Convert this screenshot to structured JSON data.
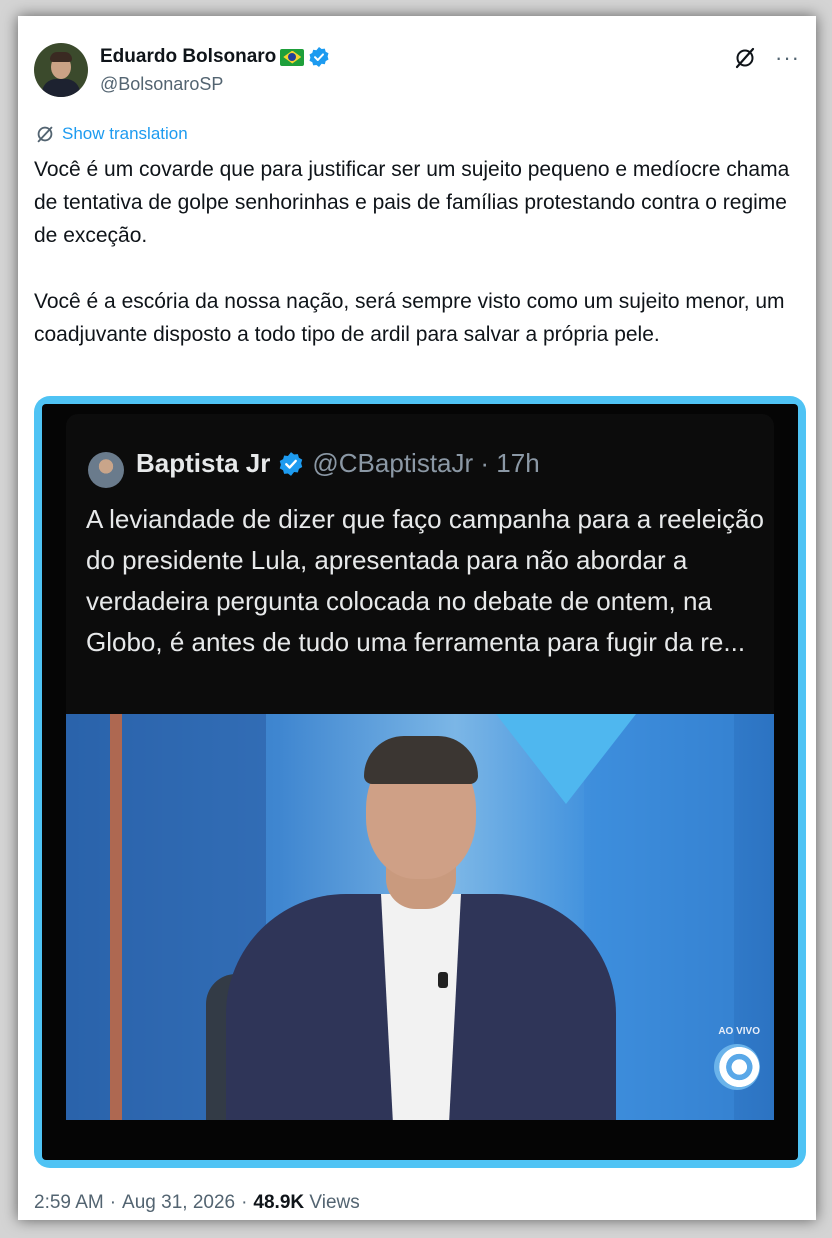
{
  "author": {
    "name": "Eduardo Bolsonaro",
    "handle": "@BolsonaroSP"
  },
  "icons": {
    "flag": "brazil-flag-icon",
    "verified": "verified-badge-icon",
    "grok": "grok-icon",
    "more": "more-options-icon",
    "translate": "translate-icon"
  },
  "colors": {
    "accent": "#1d9bf0",
    "media_border": "#4fc3f4",
    "text": "#0f1419",
    "secondary": "#536471"
  },
  "translation_link": "Show translation",
  "tweet_text": "Você é um covarde que para justificar ser um sujeito pequeno e medíocre chama de tentativa de golpe senhorinhas e pais de famílias protestando contra o regime de exceção.\n\nVocê é a escória da nossa nação, será sempre visto como um sujeito menor, um coadjuvante disposto a todo tipo de ardil para salvar a própria pele.",
  "quoted": {
    "name": "Baptista Jr",
    "handle_time": "@CBaptistaJr · 17h",
    "text": "A leviandade de dizer que faço campanha para a reeleição do presidente Lula, apresentada para não abordar a verdadeira pergunta colocada no debate de ontem, na Globo, é antes de tudo uma ferramenta para fugir da re...",
    "broadcast_label": "AO VIVO"
  },
  "meta": {
    "time": "2:59 AM",
    "sep1": "·",
    "date": "Aug 31, 2026",
    "sep2": "·",
    "views_count": "48.9K",
    "views_label": "Views"
  }
}
